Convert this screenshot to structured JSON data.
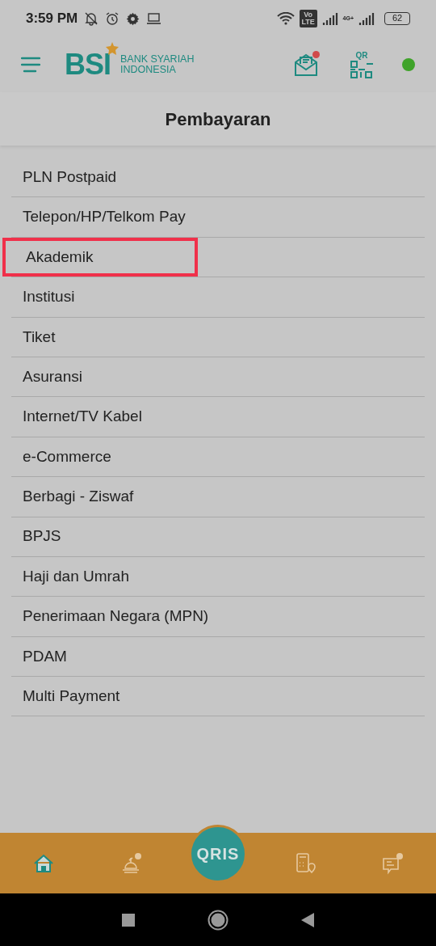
{
  "status_bar": {
    "time": "3:59 PM",
    "volte": "Vo LTE",
    "network": "4G+",
    "battery": "62"
  },
  "header": {
    "logo_mark": "BSI",
    "logo_line_1": "BANK SYARIAH",
    "logo_line_2": "INDONESIA",
    "qr_label": "QR",
    "inbox_unread": true,
    "online": true
  },
  "title": "Pembayaran",
  "items": [
    {
      "label": "PLN Postpaid",
      "highlighted": false
    },
    {
      "label": "Telepon/HP/Telkom Pay",
      "highlighted": false
    },
    {
      "label": "Akademik",
      "highlighted": true
    },
    {
      "label": "Institusi",
      "highlighted": false
    },
    {
      "label": "Tiket",
      "highlighted": false
    },
    {
      "label": "Asuransi",
      "highlighted": false
    },
    {
      "label": "Internet/TV Kabel",
      "highlighted": false
    },
    {
      "label": "e-Commerce",
      "highlighted": false
    },
    {
      "label": "Berbagi - Ziswaf",
      "highlighted": false
    },
    {
      "label": "BPJS",
      "highlighted": false
    },
    {
      "label": "Haji dan Umrah",
      "highlighted": false
    },
    {
      "label": "Penerimaan Negara (MPN)",
      "highlighted": false
    },
    {
      "label": "PDAM",
      "highlighted": false
    },
    {
      "label": "Multi Payment",
      "highlighted": false
    }
  ],
  "bottom_nav": {
    "center_label": "QRIS",
    "tabs": [
      {
        "kind": "home",
        "selected": true
      },
      {
        "kind": "mosque",
        "selected": false
      },
      {
        "kind": "atm",
        "selected": false
      },
      {
        "kind": "help",
        "selected": false
      }
    ]
  }
}
